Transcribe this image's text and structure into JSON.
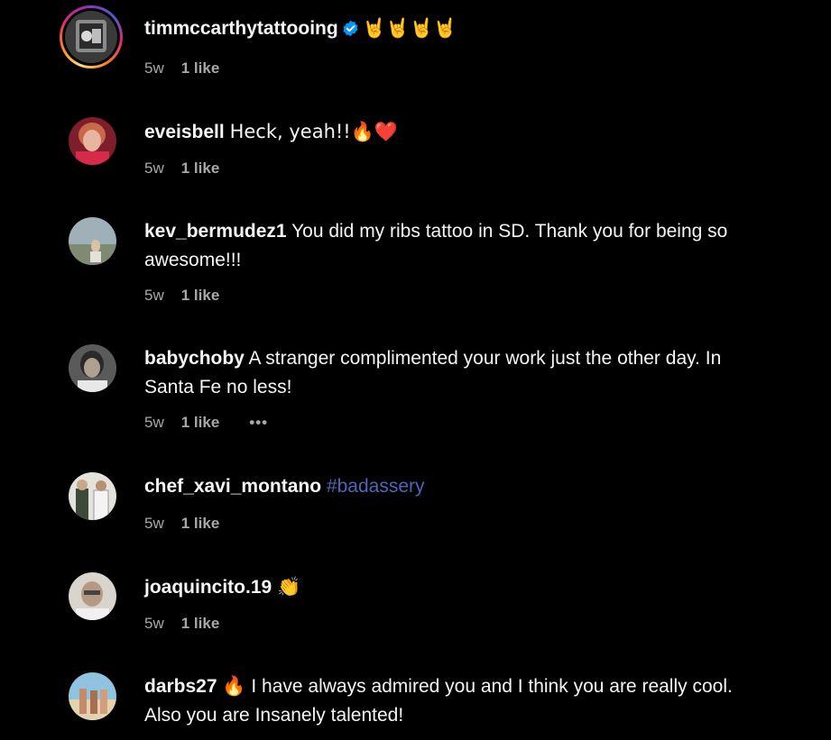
{
  "comments": [
    {
      "username": "timmccarthytattooing",
      "verified": true,
      "text": "🤘🤘🤘🤘",
      "time": "5w",
      "likes": "1 like"
    },
    {
      "username": "eveisbell",
      "text": "Heck, yeah!!🔥❤️",
      "time": "5w",
      "likes": "1 like"
    },
    {
      "username": "kev_bermudez1",
      "text": "You did my ribs tattoo in SD. Thank you for being so awesome!!!",
      "time": "5w",
      "likes": "1 like"
    },
    {
      "username": "babychoby",
      "text": "A stranger complimented your work just the other day. In Santa Fe no less!",
      "time": "5w",
      "likes": "1 like",
      "more": "•••"
    },
    {
      "username": "chef_xavi_montano",
      "hashtag": "#badassery",
      "time": "5w",
      "likes": "1 like"
    },
    {
      "username": "joaquincito.19",
      "text": "👏",
      "time": "5w",
      "likes": "1 like"
    },
    {
      "username": "darbs27",
      "text": "🔥 I have always admired you and I think you are really cool. Also you are Insanely talented!"
    }
  ],
  "icons": {
    "verified": "verified-badge-icon",
    "more": "more-options-icon"
  },
  "colors": {
    "background": "#000000",
    "username": "#f5f5f5",
    "meta": "#a8a8a8",
    "hashtag": "#4c67b7",
    "verified": "#0095f6"
  }
}
